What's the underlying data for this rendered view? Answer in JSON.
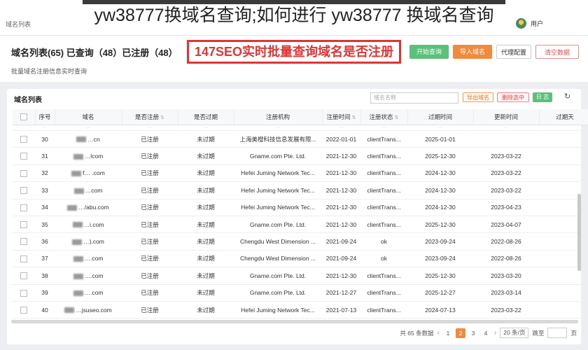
{
  "overlay_title": "yw38777换域名查询;如何进行 yw38777 换域名查询",
  "breadcrumb": "域名列表",
  "user": {
    "name": "用户",
    "avatar_icon": "user-avatar"
  },
  "header": {
    "stats_title": "域名列表(65) 已查询（48）已注册（48）",
    "subtitle": "批量域名注册信息实时查询",
    "banner": "147SEO实时批量查询域名是否注册",
    "buttons": {
      "start": "开始查询",
      "import": "导入域名",
      "proxy": "代理配置",
      "clear": "清空数据"
    }
  },
  "card": {
    "title": "域名列表",
    "search_placeholder": "域名名称",
    "export": "导出域名",
    "delete": "删除选中",
    "log": "日 志",
    "refresh_icon": "refresh"
  },
  "table": {
    "columns": [
      "",
      "序号",
      "域名",
      "是否注册",
      "是否过期",
      "注册机构",
      "注册时间",
      "注册状态",
      "过期时间",
      "更新时间",
      "过期天"
    ],
    "partial_row": [
      "",
      "…",
      "…",
      "…",
      "…",
      "…",
      "…",
      "…",
      "…",
      "…",
      ""
    ],
    "rows": [
      {
        "no": "30",
        "domain": "…cn",
        "registered": "已注册",
        "expired": "未过期",
        "registrar": "上海美橙科技信息发展有限...",
        "reg_date": "2022-01-01",
        "status": "clientTrans...",
        "exp_date": "2025-01-01",
        "upd_date": ""
      },
      {
        "no": "31",
        "domain": "…lcom",
        "registered": "已注册",
        "expired": "未过期",
        "registrar": "Gname.com Pte. Ltd.",
        "reg_date": "2021-12-30",
        "status": "clientTrans...",
        "exp_date": "2025-12-30",
        "upd_date": "2023-03-22"
      },
      {
        "no": "32",
        "domain": "f… .com",
        "registered": "已注册",
        "expired": "未过期",
        "registrar": "Hefei Juming Network Tec...",
        "reg_date": "2021-12-30",
        "status": "clientTrans...",
        "exp_date": "2024-12-30",
        "upd_date": "2023-03-22"
      },
      {
        "no": "33",
        "domain": "…com",
        "registered": "已注册",
        "expired": "未过期",
        "registrar": "Hefei Juming Network Tec...",
        "reg_date": "2021-12-30",
        "status": "clientTrans...",
        "exp_date": "2024-12-30",
        "upd_date": "2023-03-22"
      },
      {
        "no": "34",
        "domain": "…/abu.com",
        "registered": "已注册",
        "expired": "未过期",
        "registrar": "Hefei Juming Network Tec...",
        "reg_date": "2021-12-30",
        "status": "clientTrans...",
        "exp_date": "2024-12-30",
        "upd_date": "2023-04-23"
      },
      {
        "no": "35",
        "domain": "…i.com",
        "registered": "已注册",
        "expired": "未过期",
        "registrar": "Gname.com Pte. Ltd.",
        "reg_date": "2021-12-30",
        "status": "clientTrans...",
        "exp_date": "2025-12-30",
        "upd_date": "2023-04-07"
      },
      {
        "no": "36",
        "domain": "…).com",
        "registered": "已注册",
        "expired": "未过期",
        "registrar": "Chengdu West Dimension ...",
        "reg_date": "2021-09-24",
        "status": "ok",
        "exp_date": "2023-09-24",
        "upd_date": "2022-08-26"
      },
      {
        "no": "37",
        "domain": "….com",
        "registered": "已注册",
        "expired": "未过期",
        "registrar": "Chengdu West Dimension ...",
        "reg_date": "2021-09-24",
        "status": "ok",
        "exp_date": "2023-09-24",
        "upd_date": "2022-08-26"
      },
      {
        "no": "38",
        "domain": "….com",
        "registered": "已注册",
        "expired": "未过期",
        "registrar": "Gname.com Pte. Ltd.",
        "reg_date": "2021-12-30",
        "status": "clientTrans...",
        "exp_date": "2025-12-30",
        "upd_date": "2023-03-20"
      },
      {
        "no": "39",
        "domain": "….com",
        "registered": "已注册",
        "expired": "未过期",
        "registrar": "Gname.com Pte. Ltd.",
        "reg_date": "2021-12-27",
        "status": "clientTrans...",
        "exp_date": "2025-12-27",
        "upd_date": "2023-03-14"
      },
      {
        "no": "40",
        "domain": "…jsuseo.com",
        "registered": "已注册",
        "expired": "未过期",
        "registrar": "Hefei Juming Network Tec...",
        "reg_date": "2021-07-13",
        "status": "clientTrans...",
        "exp_date": "2024-07-13",
        "upd_date": "2023-03-22"
      }
    ]
  },
  "pagination": {
    "total": "共 65 条数据",
    "pages": [
      "1",
      "2",
      "3",
      "4"
    ],
    "current": "2",
    "size": "20 条/页",
    "goto_label": "跳至",
    "page_suffix": "页"
  },
  "colors": {
    "accent": "#f08a3c",
    "success": "#5bc07a",
    "banner_red": "#e03535"
  }
}
